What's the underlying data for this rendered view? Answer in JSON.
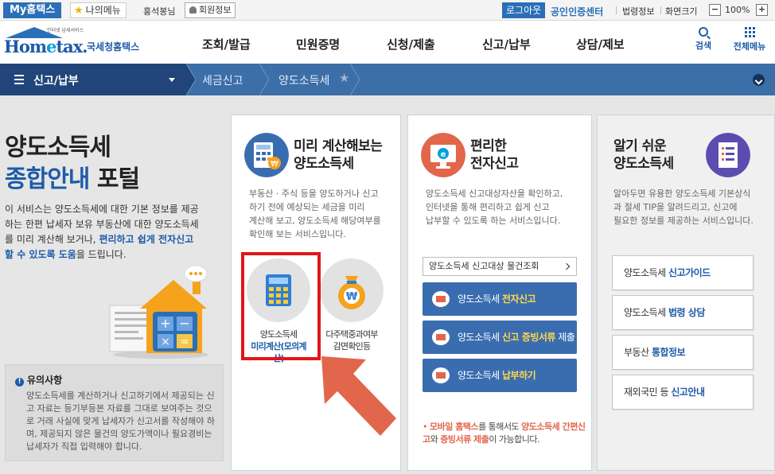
{
  "topbar": {
    "my_hometax": "My홈택스",
    "my_menu": "나의메뉴",
    "user_name": "홍석봉님",
    "member_info": "회원정보",
    "logout": "로그아웃",
    "cert_center": "공인인증센터",
    "law_info": "법령정보",
    "screen_size": "화면크기",
    "zoom_minus": "−",
    "zoom_value": "100%",
    "zoom_plus": "+"
  },
  "header": {
    "logo_small": "인터넷 납세서비스",
    "logo_brand_pre": "Hom",
    "logo_brand_e": "e",
    "logo_brand_post": "tax.",
    "logo_kr": "국세청홈택스",
    "nav": [
      "조회/발급",
      "민원증명",
      "신청/제출",
      "신고/납부",
      "상담/제보"
    ],
    "search": "검색",
    "all_menu": "전체메뉴"
  },
  "breadcrumb": {
    "main": "신고/납부",
    "level2": "세금신고",
    "level3": "양도소득세"
  },
  "intro": {
    "title_line1": "양도소득세",
    "title_line2_hl": "종합안내",
    "title_line2_rest": " 포털",
    "desc_plain": "이 서비스는 양도소득세에 대한 기본 정보를 제공하는 한편 납세자 보유 부동산에 대한 양도소득세를 미리 계산해 보거나, ",
    "desc_hl": "편리하고 쉽게 전자신고할 수 있도록 도움",
    "desc_end": "을 드립니다."
  },
  "notice": {
    "title": "유의사항",
    "text": "양도소득세를 계산하거나 신고하기에서 제공되는 신고 자료는 등기부등본 자료를 그대로 보여주는 것으로 거래 사실에 맞게 납세자가 신고서를 작성해야 하며, 제공되지 않은 물건의 양도가액이나 필요경비는 납세자가 직접 입력해야 합니다."
  },
  "panel_calc": {
    "title": "미리 계산해보는\n양도소득세",
    "desc": "부동산 · 주식 등을 양도하거나 신고\n하기 전에 예상되는 세금을 미리\n계산해 보고, 양도소득세 해당여부를\n확인해 보는 서비스입니다.",
    "card1_line1": "양도소득세",
    "card1_line2": "미리계산(모의계산)",
    "card2_line1": "다주택중과여부",
    "card2_line2": "감면확인등"
  },
  "panel_efile": {
    "title": "편리한\n전자신고",
    "desc": "양도소득세 신고대상자산을 확인하고,\n인터넷을 통해 편리하고 쉽게 신고\n납부할 수 있도록 하는 서비스입니다.",
    "lookup": "양도소득세 신고대상 물건조회",
    "btn1_pre": "양도소득세 ",
    "btn1_hl": "전자신고",
    "btn1_post": "",
    "btn2_pre": "양도소득세 ",
    "btn2_hl": "신고 증빙서류",
    "btn2_post": " 제출",
    "btn3_pre": "양도소득세 ",
    "btn3_hl": "납부하기",
    "btn3_post": "",
    "mobile_1": "모바일 홈택스",
    "mobile_2": "를 통해서도 ",
    "mobile_3": "양도소득세 간편신고",
    "mobile_4": "와 ",
    "mobile_5": "증빙서류 제출",
    "mobile_6": "이 가능합니다."
  },
  "panel_guide": {
    "title": "알기 쉬운\n양도소득세",
    "desc": "알아두면 유용한 양도소득세 기본상식\n과 절세 TIP을 알려드리고, 신고에\n필요한 정보를 제공하는 서비스입니다.",
    "items": [
      {
        "pre": "양도소득세 ",
        "hl": "신고가이드"
      },
      {
        "pre": "양도소득세 ",
        "hl": "법령 상담"
      },
      {
        "pre": "부동산 ",
        "hl": "통합정보"
      },
      {
        "pre": "재외국민 등 ",
        "hl": "신고안내"
      }
    ]
  },
  "colors": {
    "brand_blue": "#1d5ba8",
    "nav_dark": "#21457a",
    "highlight_red": "#e0161b",
    "arrow_orange": "#e2664b"
  }
}
